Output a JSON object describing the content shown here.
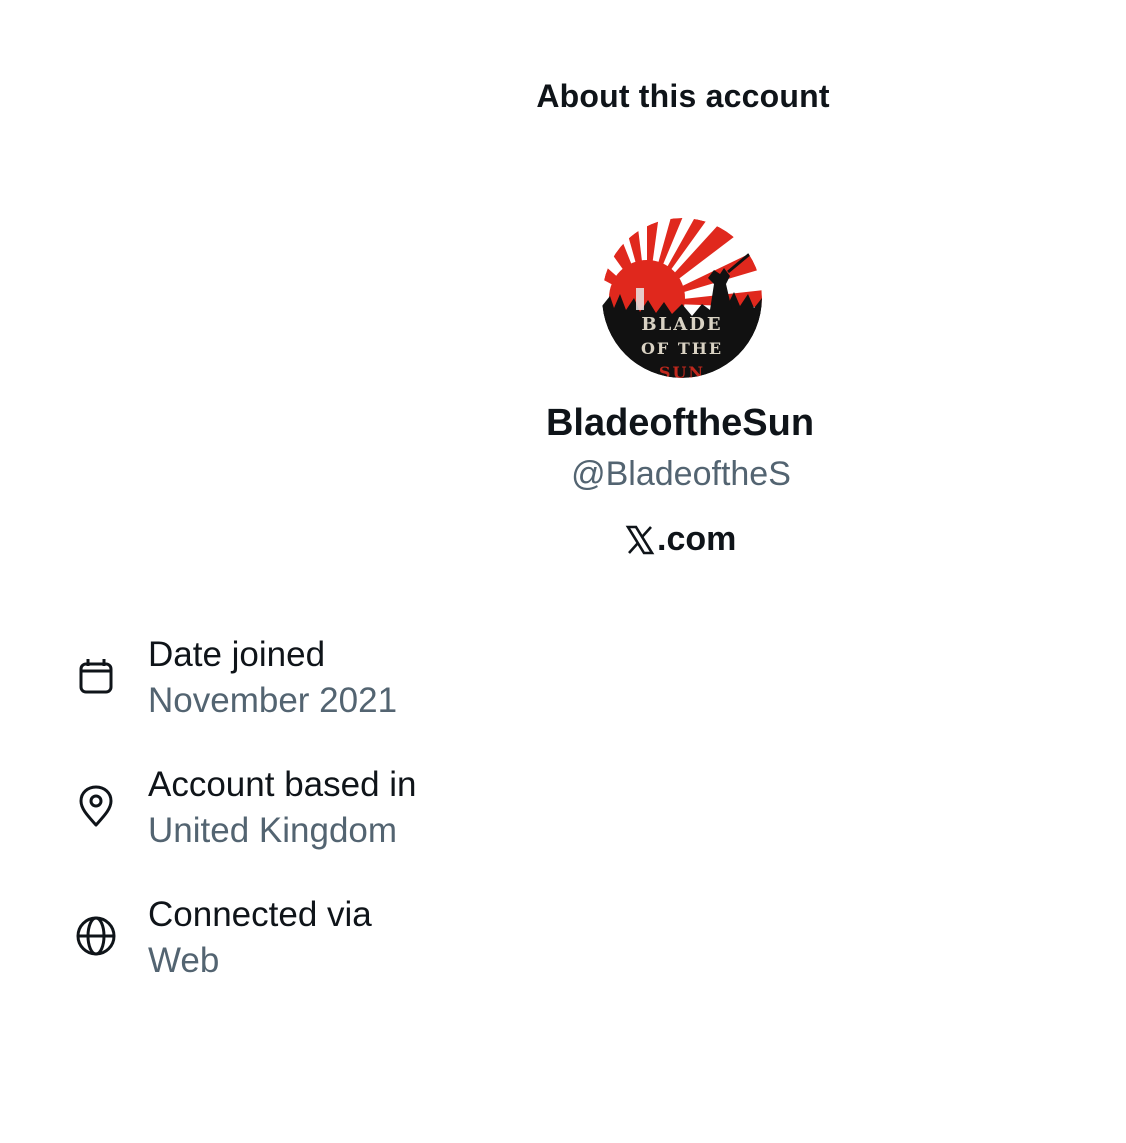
{
  "header": {
    "title": "About this account"
  },
  "profile": {
    "display_name": "BladeoftheSun",
    "handle": "@BladeoftheS",
    "site_suffix": ".com",
    "avatar_lettering": "BLADE OF THE SUN",
    "avatar_colors": {
      "sun_red": "#e0281d",
      "ray_white": "#ffffff",
      "ground_black": "#111111"
    }
  },
  "details": [
    {
      "icon": "calendar-icon",
      "label": "Date joined",
      "value": "November 2021"
    },
    {
      "icon": "location-pin-icon",
      "label": "Account based in",
      "value": "United Kingdom"
    },
    {
      "icon": "globe-icon",
      "label": "Connected via",
      "value": "Web"
    }
  ],
  "colors": {
    "text_primary": "#0f1419",
    "text_secondary": "#536471",
    "background": "#ffffff"
  }
}
